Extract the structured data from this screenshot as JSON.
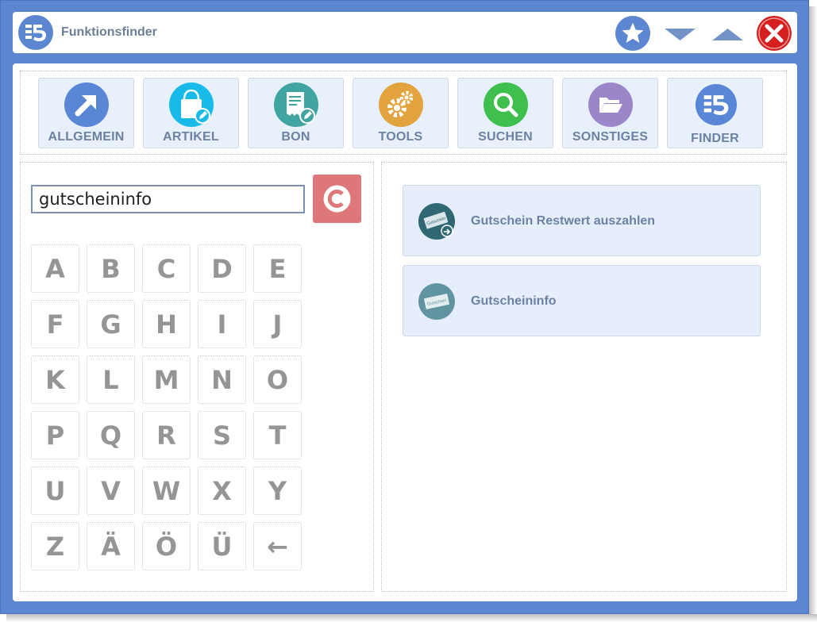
{
  "window": {
    "title": "Funktionsfinder",
    "colors": {
      "frame": "#5d86d1",
      "panel": "#e8f0fc",
      "label": "#6d81a3",
      "close": "#d51f1f",
      "clear": "#de7779"
    }
  },
  "titlebar_icons": {
    "app": "app-logo-icon",
    "favorite": "star-icon",
    "minimize": "triangle-down-icon",
    "maximize": "triangle-up-icon",
    "close": "close-x-icon"
  },
  "nav": {
    "items": [
      {
        "label": "ALLGEMEIN",
        "icon": "arrow-up-right-icon",
        "color": "#5a86d6"
      },
      {
        "label": "ARTIKEL",
        "icon": "shopping-bag-edit-icon",
        "color": "#18bbe8"
      },
      {
        "label": "BON",
        "icon": "receipt-edit-icon",
        "color": "#40a4a0"
      },
      {
        "label": "TOOLS",
        "icon": "gears-icon",
        "color": "#e3a33e"
      },
      {
        "label": "SUCHEN",
        "icon": "magnifier-icon",
        "color": "#3fbf4e"
      },
      {
        "label": "SONSTIGES",
        "icon": "folder-icon",
        "color": "#9b86c9"
      },
      {
        "label": "FINDER",
        "icon": "finder-logo-icon",
        "color": "#5a86d6"
      }
    ]
  },
  "search": {
    "value": "gutscheininfo",
    "clear_icon": "clear-c-icon"
  },
  "keypad": {
    "keys": [
      "A",
      "B",
      "C",
      "D",
      "E",
      "F",
      "G",
      "H",
      "I",
      "J",
      "K",
      "L",
      "M",
      "N",
      "O",
      "P",
      "Q",
      "R",
      "S",
      "T",
      "U",
      "V",
      "W",
      "X",
      "Y",
      "Z",
      "Ä",
      "Ö",
      "Ü",
      "←"
    ]
  },
  "results": {
    "items": [
      {
        "label": "Gutschein Restwert auszahlen",
        "icon": "voucher-payout-icon",
        "icon_text": "Gutschein"
      },
      {
        "label": "Gutscheininfo",
        "icon": "voucher-info-icon",
        "icon_text": "Gutschein"
      }
    ]
  }
}
